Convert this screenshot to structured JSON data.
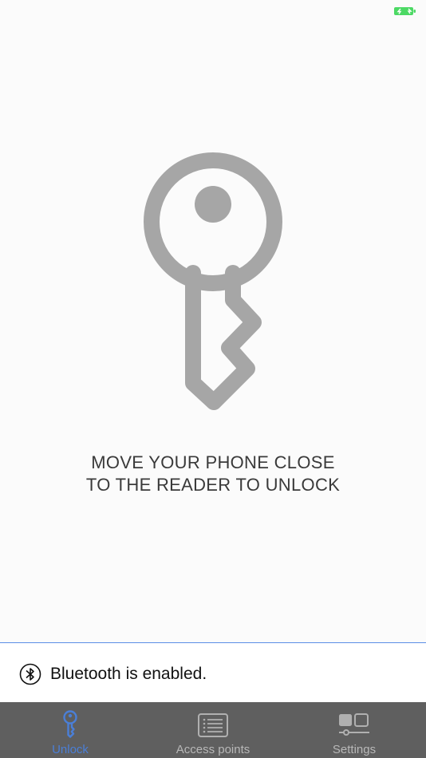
{
  "status_bar": {
    "battery_icon": "battery-charging-icon",
    "battery_color": "#4cd964"
  },
  "main": {
    "icon": "key-icon",
    "instruction_line1": "MOVE YOUR PHONE CLOSE",
    "instruction_line2": "TO THE READER TO UNLOCK"
  },
  "bluetooth": {
    "icon": "bluetooth-icon",
    "status_text": "Bluetooth is enabled."
  },
  "tabs": [
    {
      "label": "Unlock",
      "icon": "key-icon",
      "active": true
    },
    {
      "label": "Access points",
      "icon": "list-icon",
      "active": false
    },
    {
      "label": "Settings",
      "icon": "settings-toggle-icon",
      "active": false
    }
  ],
  "colors": {
    "accent": "#4a7fd8",
    "key_gray": "#a6a6a6",
    "tab_bar_bg": "#5f5f5f",
    "divider": "#5b8ee6"
  }
}
